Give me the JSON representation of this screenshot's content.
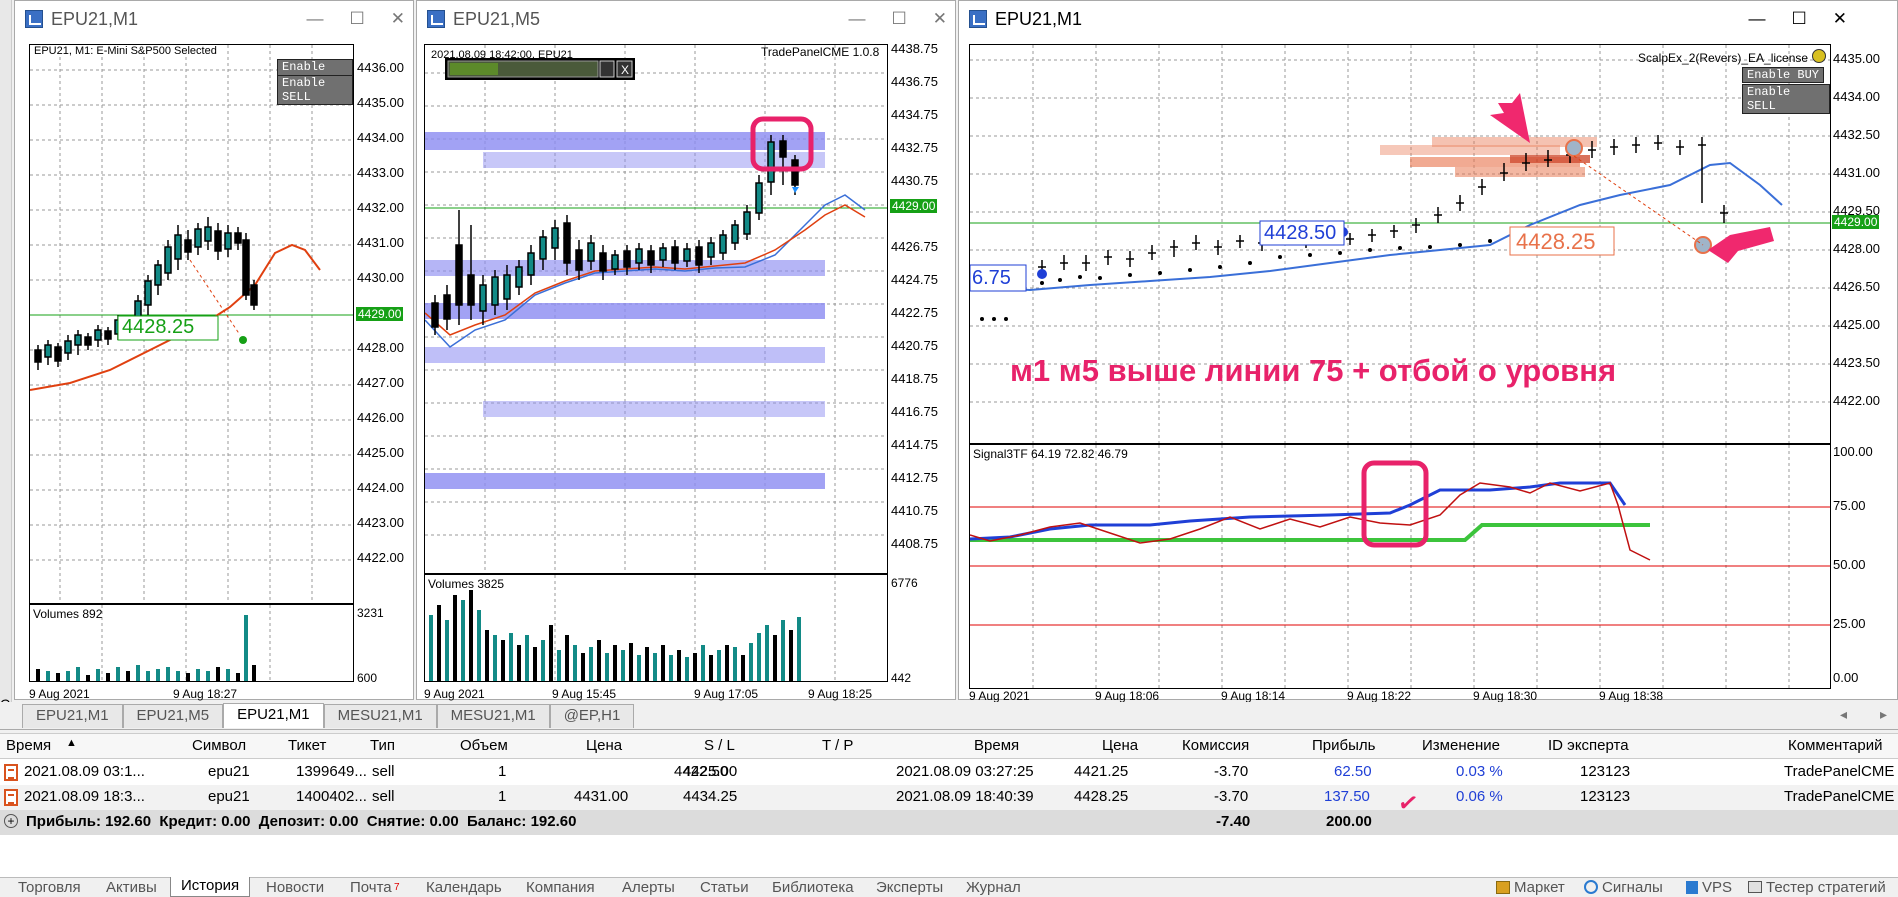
{
  "windows": [
    {
      "title": "EPU21,M1",
      "ea_label": "EPU21, M1:  E-Mini S&P500 Selected",
      "enable_buy": "Enable BUY",
      "enable_sell": "Enable SELL",
      "price_ticks": [
        "4436.00",
        "4435.00",
        "4434.00",
        "4433.00",
        "4432.00",
        "4431.00",
        "4430.00",
        "4429.00",
        "4428.00",
        "4427.00",
        "4426.00",
        "4425.00",
        "4424.00",
        "4423.00",
        "4422.00"
      ],
      "current_price": "4429.00",
      "entry_price_label": "4428.25",
      "volumes_label": "Volumes 892",
      "vol_ticks": [
        "3231",
        "0"
      ],
      "vol_low": "600",
      "time_ticks": [
        "9 Aug 2021",
        "9 Aug 18:27"
      ]
    },
    {
      "title": "EPU21,M5",
      "panel_label": "TradePanelCME 1.0.8",
      "header_text": "2021.08.09 18:42:00, EPU21",
      "price_ticks": [
        "4438.75",
        "4436.75",
        "4434.75",
        "4432.75",
        "4430.75",
        "4428.75",
        "4426.75",
        "4424.75",
        "4422.75",
        "4420.75",
        "4418.75",
        "4416.75",
        "4414.75",
        "4412.75",
        "4410.75",
        "4408.75"
      ],
      "current_price": "4429.00",
      "volumes_label": "Volumes 3825",
      "vol_ticks": [
        "6776",
        "442"
      ],
      "time_ticks": [
        "9 Aug 2021",
        "9 Aug 15:45",
        "9 Aug 17:05",
        "9 Aug 18:25"
      ]
    },
    {
      "title": "EPU21,M1",
      "ea_label": "ScalpEx_2(Revers)_EA_license",
      "enable_buy": "Enable BUY",
      "enable_sell": "Enable SELL",
      "price_ticks": [
        "4435.00",
        "4434.00",
        "4432.50",
        "4431.00",
        "4429.50",
        "4428.00",
        "4426.50",
        "4425.00",
        "4423.50",
        "4422.00",
        "4420.50"
      ],
      "current_price": "4429.00",
      "level_label_1": "4428.50",
      "level_label_2": "4428.25",
      "level_label_3": "6.75",
      "annotation": "м1 м5 выше линии 75 + отбой о уровня",
      "indicator_label": "Signal3TF 64.19 72.82 46.79",
      "ind_ticks": [
        "100.00",
        "75.00",
        "50.00",
        "25.00",
        "0.00"
      ],
      "time_ticks": [
        "9 Aug 2021",
        "9 Aug 18:06",
        "9 Aug 18:14",
        "9 Aug 18:22",
        "9 Aug 18:30",
        "9 Aug 18:38"
      ]
    }
  ],
  "left_edge_label": "C",
  "chart_tabs": [
    "EPU21,M1",
    "EPU21,M5",
    "EPU21,M1",
    "MESU21,M1",
    "MESU21,M1",
    "@EP,H1"
  ],
  "active_chart_tab": 2,
  "table": {
    "headers": [
      "Время",
      "Символ",
      "Тикет",
      "Тип",
      "Объем",
      "Цена",
      "S / L",
      "T / P",
      "Время",
      "Цена",
      "Комиссия",
      "Прибыль",
      "Изменение",
      "ID эксперта",
      "Комментарий"
    ],
    "rows": [
      [
        "2021.08.09 03:1...",
        "epu21",
        "1399649...",
        "sell",
        "1",
        "4422.50",
        "4425.00",
        "",
        "2021.08.09 03:27:25",
        "4421.25",
        "-3.70",
        "62.50",
        "0.03 %",
        "123123",
        "TradePanelCME"
      ],
      [
        "2021.08.09 18:3...",
        "epu21",
        "1400402...",
        "sell",
        "1",
        "4431.00",
        "4434.25",
        "",
        "2021.08.09 18:40:39",
        "4428.25",
        "-3.70",
        "137.50",
        "0.06 %",
        "123123",
        "TradePanelCME"
      ]
    ],
    "summary": "Прибыль: 192.60  Кредит: 0.00  Депозит: 0.00  Снятие: 0.00  Баланс: 192.60",
    "summary_commission": "-7.40",
    "summary_profit": "200.00"
  },
  "bottom_tabs": [
    "Торговля",
    "Активы",
    "История",
    "Новости",
    "Почта",
    "Календарь",
    "Компания",
    "Алерты",
    "Статьи",
    "Библиотека",
    "Эксперты",
    "Журнал"
  ],
  "mail_badge": "7",
  "active_bottom_tab": 2,
  "bottom_right": [
    "Маркет",
    "Сигналы",
    "VPS",
    "Тестер стратегий"
  ],
  "colors": {
    "accent": "#e8226a",
    "buy_line": "#16a016",
    "zone_blue": "#8c8cf2",
    "ma_blue": "#3a6fd8",
    "ma_red": "#e04010",
    "ind_red": "#e00000",
    "ind_green": "#3cc43c",
    "ind_blue": "#1f3fd6"
  }
}
